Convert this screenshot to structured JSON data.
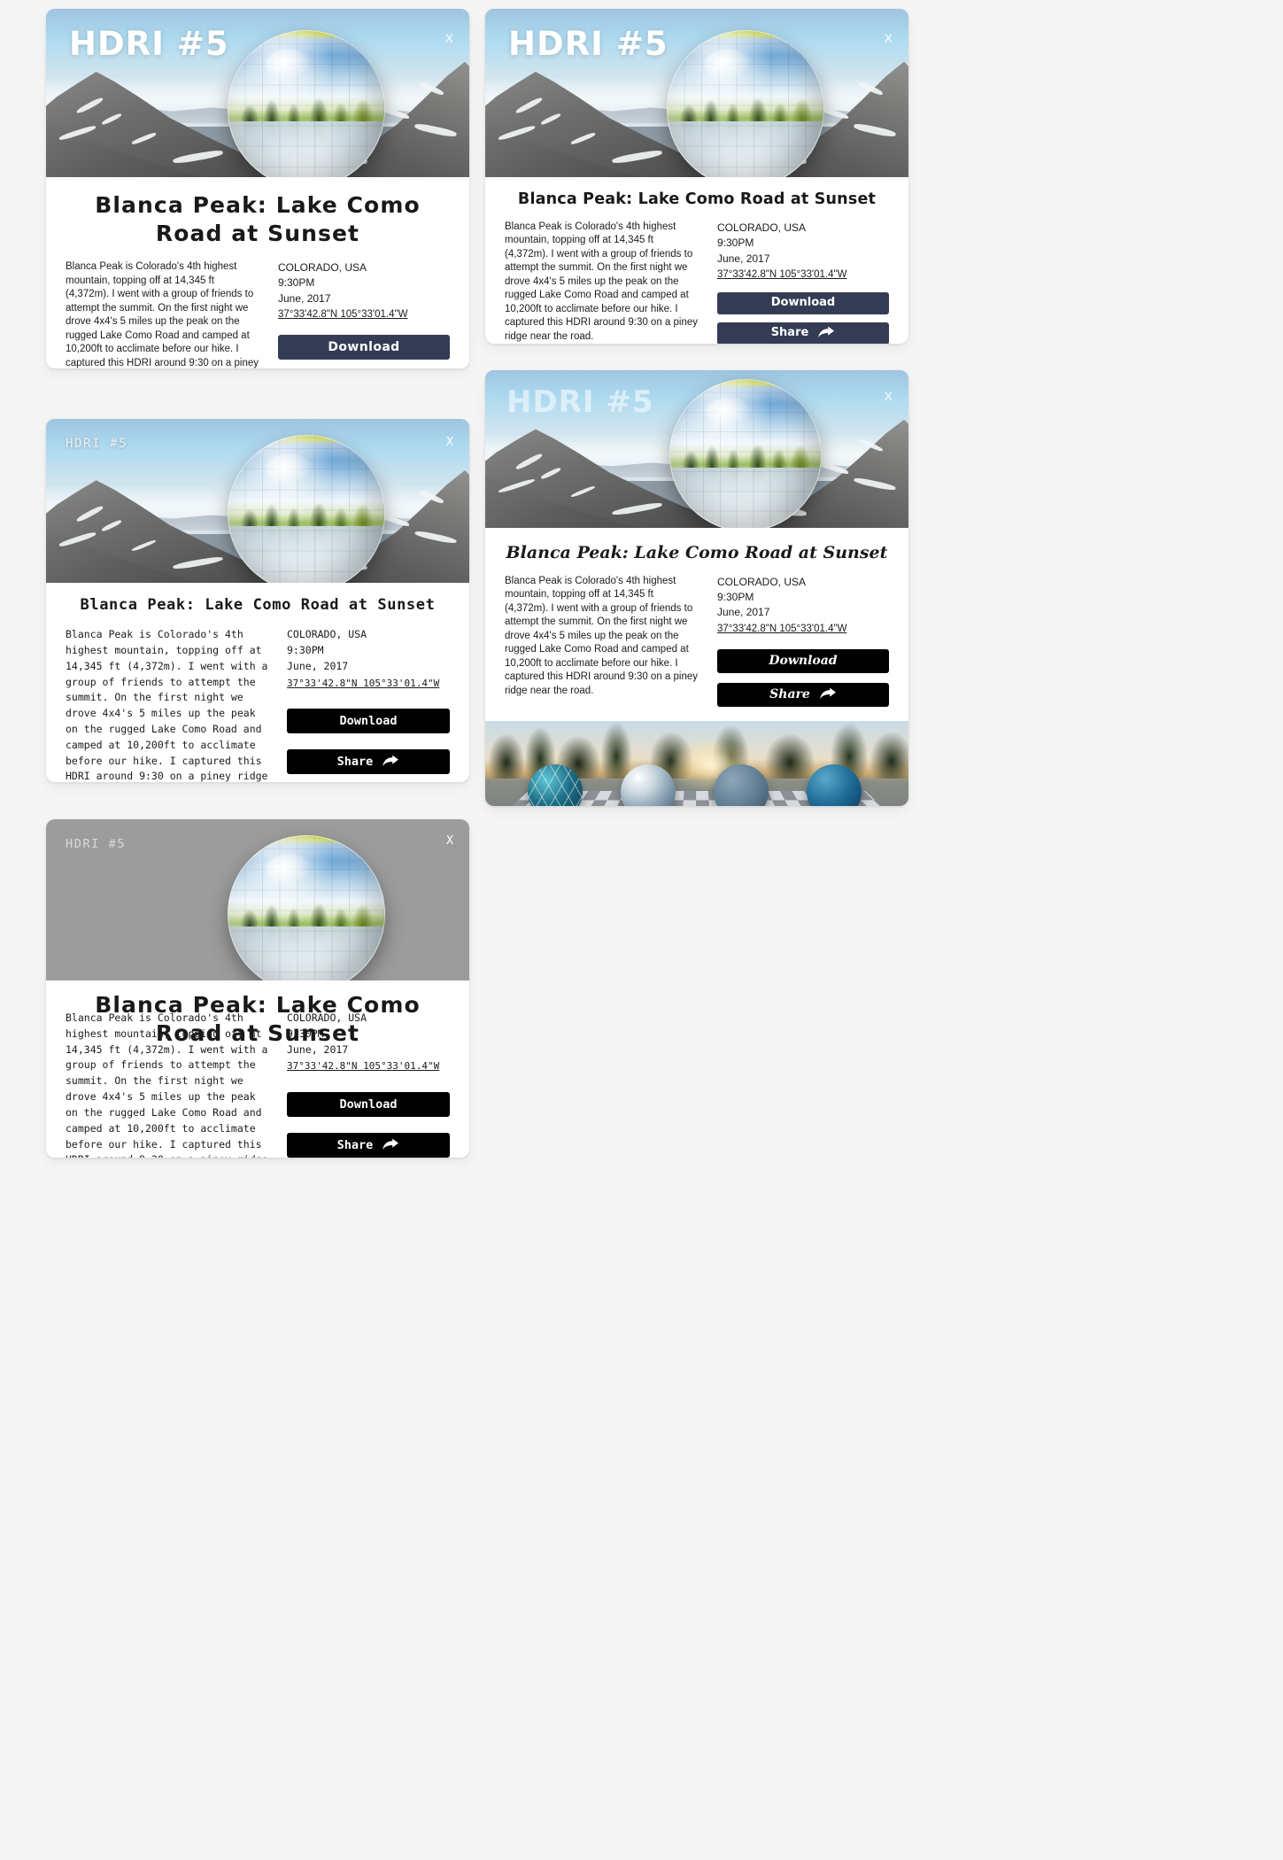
{
  "content": {
    "hero_label": "HDRI #5",
    "close_label": "X",
    "title": "Blanca Peak: Lake Como Road at Sunset",
    "description": "Blanca Peak is Colorado's 4th highest mountain, topping off at 14,345 ft (4,372m). I went with a group of friends to attempt the summit. On the first night we drove 4x4's 5 miles up the peak on the rugged Lake Como Road and camped at 10,200ft to acclimate before our hike. I captured this HDRI around 9:30 on a piney ridge near the road.",
    "meta": {
      "location": "COLORADO, USA",
      "time": "9:30PM",
      "date": "June, 2017",
      "coordinates": "37°33'42.8\"N 105°33'01.4\"W"
    },
    "buttons": {
      "download": "Download",
      "share": "Share"
    },
    "colors": {
      "navy_button": "#343c55",
      "black_button": "#000000",
      "page_background": "#f5f5f5",
      "card_background": "#ffffff",
      "title_text": "#191919"
    }
  },
  "cards": [
    {
      "id": "card1",
      "name": "variant-navy-display",
      "title_style": "display-sans-large",
      "button_color": "#343c55"
    },
    {
      "id": "card2",
      "name": "variant-navy-compact",
      "title_style": "display-sans-small",
      "button_color": "#343c55"
    },
    {
      "id": "card3",
      "name": "variant-monospace",
      "title_style": "monospace",
      "button_color": "#000000"
    },
    {
      "id": "card4",
      "name": "variant-serif-italic",
      "title_style": "serif-italic",
      "button_color": "#000000"
    },
    {
      "id": "card5",
      "name": "variant-mixed-overlap",
      "title_style": "display-sans-large",
      "button_color": "#000000"
    }
  ],
  "icons": {
    "share_arrow": "share-arrow-icon",
    "close": "close-icon"
  }
}
